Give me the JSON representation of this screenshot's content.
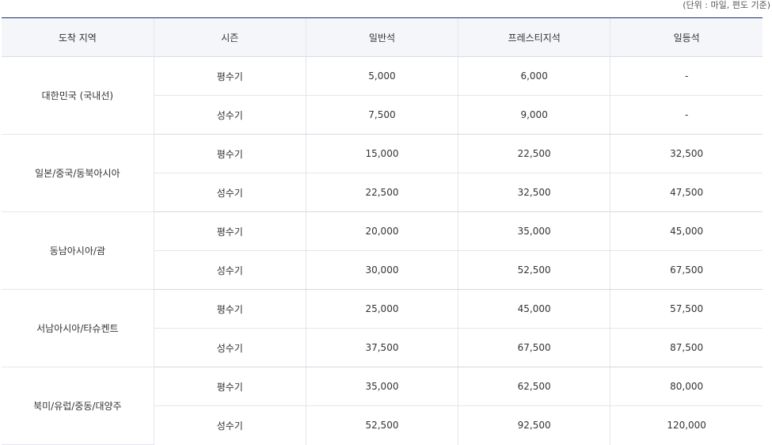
{
  "unit_note": "(단위 : 마일, 편도 기준)",
  "headers": [
    "도착 지역",
    "시즌",
    "일반석",
    "프레스티지석",
    "일등석"
  ],
  "groups": [
    {
      "region": "대한민국 (국내선)",
      "rows": [
        {
          "season": "평수기",
          "economy": "5,000",
          "prestige": "6,000",
          "first": "-"
        },
        {
          "season": "성수기",
          "economy": "7,500",
          "prestige": "9,000",
          "first": "-"
        }
      ]
    },
    {
      "region": "일본/중국/동북아시아",
      "rows": [
        {
          "season": "평수기",
          "economy": "15,000",
          "prestige": "22,500",
          "first": "32,500"
        },
        {
          "season": "성수기",
          "economy": "22,500",
          "prestige": "32,500",
          "first": "47,500"
        }
      ]
    },
    {
      "region": "동남아시아/괌",
      "rows": [
        {
          "season": "평수기",
          "economy": "20,000",
          "prestige": "35,000",
          "first": "45,000"
        },
        {
          "season": "성수기",
          "economy": "30,000",
          "prestige": "52,500",
          "first": "67,500"
        }
      ]
    },
    {
      "region": "서남아시아/타슈켄트",
      "rows": [
        {
          "season": "평수기",
          "economy": "25,000",
          "prestige": "45,000",
          "first": "57,500"
        },
        {
          "season": "성수기",
          "economy": "37,500",
          "prestige": "67,500",
          "first": "87,500"
        }
      ]
    },
    {
      "region": "북미/유럽/중동/대양주",
      "rows": [
        {
          "season": "평수기",
          "economy": "35,000",
          "prestige": "62,500",
          "first": "80,000"
        },
        {
          "season": "성수기",
          "economy": "52,500",
          "prestige": "92,500",
          "first": "120,000"
        }
      ]
    }
  ]
}
